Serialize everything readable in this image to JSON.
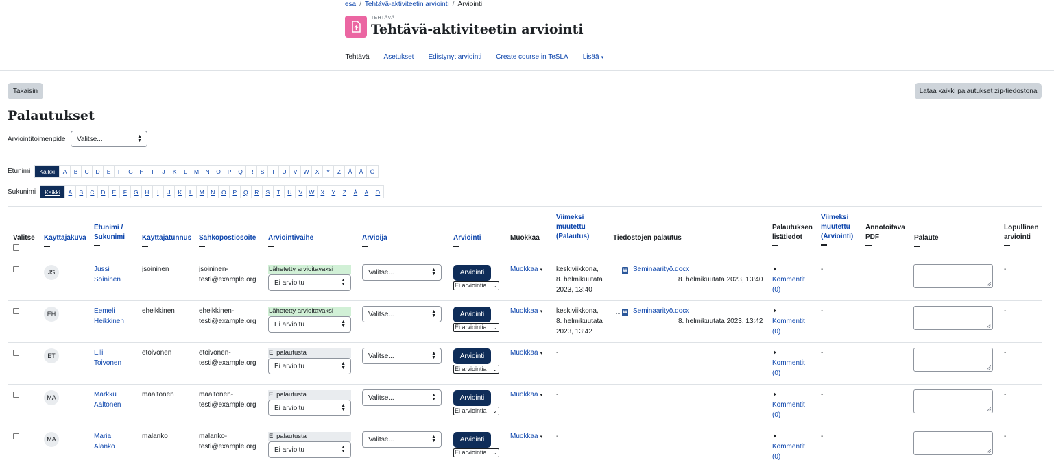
{
  "breadcrumb": [
    "esa",
    "Tehtävä-aktiviteetin arviointi",
    "Arviointi"
  ],
  "activity": {
    "kind": "TEHTÄVÄ",
    "title": "Tehtävä-aktiviteetin arviointi",
    "icon": "assignment-upload-icon",
    "icon_color": "#eb66a2"
  },
  "nav": {
    "tabs": [
      "Tehtävä",
      "Asetukset",
      "Edistynyt arviointi",
      "Create course in TeSLA",
      "Lisää"
    ],
    "active": "Tehtävä"
  },
  "buttons": {
    "back": "Takaisin",
    "download_all": "Lataa kaikki palautukset zip-tiedostona"
  },
  "page_title": "Palautukset",
  "grading_action": {
    "label": "Arviointitoimenpide",
    "value": "Valitse..."
  },
  "first_name_filter": {
    "label": "Etunimi",
    "letters": [
      "Kaikki",
      "A",
      "B",
      "C",
      "D",
      "E",
      "F",
      "G",
      "H",
      "I",
      "J",
      "K",
      "L",
      "M",
      "N",
      "O",
      "P",
      "Q",
      "R",
      "S",
      "T",
      "U",
      "V",
      "W",
      "X",
      "Y",
      "Z",
      "Å",
      "Ä",
      "Ö"
    ],
    "selected": "Kaikki"
  },
  "last_name_filter": {
    "label": "Sukunimi",
    "letters": [
      "Kaikki",
      "A",
      "B",
      "C",
      "D",
      "E",
      "F",
      "G",
      "H",
      "I",
      "J",
      "K",
      "L",
      "M",
      "N",
      "O",
      "P",
      "Q",
      "R",
      "S",
      "T",
      "U",
      "V",
      "W",
      "X",
      "Y",
      "Z",
      "Å",
      "Ä",
      "Ö"
    ],
    "selected": "Kaikki"
  },
  "table": {
    "headers": {
      "select": "Valitse",
      "avatar": "Käyttäjäkuva",
      "name": [
        "Etunimi /",
        "Sukunimi"
      ],
      "username": "Käyttäjätunnus",
      "email": "Sähköpostiosoite",
      "status": "Arviointivaihe",
      "marker": "Arvioija",
      "grade": "Arviointi",
      "edit": "Muokkaa",
      "modified": [
        "Viimeksi",
        "muutettu",
        "(Palautus)"
      ],
      "files": "Tiedostojen palautus",
      "submission_comments": [
        "Palautuksen",
        "lisätiedot"
      ],
      "grade_modified": [
        "Viimeksi",
        "muutettu",
        "(Arviointi)"
      ],
      "annotate_pdf": [
        "Annotoitava",
        "PDF"
      ],
      "feedback": "Palaute",
      "final_grade": [
        "Lopullinen",
        "arviointi"
      ]
    },
    "rows": [
      {
        "initials": "JS",
        "first": "Jussi",
        "last": "Soininen",
        "username": "jsoininen",
        "email": [
          "jsoininen-",
          "testi@example.org"
        ],
        "status": "Lähetetty arvioitavaksi",
        "status_kind": "sent",
        "workflow": "Ei arvioitu",
        "marker": "Valitse...",
        "grade_button": "Arviointi",
        "grade_value": "Ei arviointia",
        "edit": "Muokkaa",
        "modified": [
          "keskiviikkona,",
          "8. helmikuutata",
          "2023, 13:40"
        ],
        "file": "Seminaarityö.docx",
        "file_date": "8. helmikuutata 2023, 13:40",
        "comments": [
          "Kommentit",
          "(0)"
        ],
        "grade_modified": "-",
        "final": "-"
      },
      {
        "initials": "EH",
        "first": "Eemeli",
        "last": "Heikkinen",
        "username": "eheikkinen",
        "email": [
          "eheikkinen-",
          "testi@example.org"
        ],
        "status": "Lähetetty arvioitavaksi",
        "status_kind": "sent",
        "workflow": "Ei arvioitu",
        "marker": "Valitse...",
        "grade_button": "Arviointi",
        "grade_value": "Ei arviointia",
        "edit": "Muokkaa",
        "modified": [
          "keskiviikkona,",
          "8. helmikuutata",
          "2023, 13:42"
        ],
        "file": "Seminaarityö.docx",
        "file_date": "8. helmikuutata 2023, 13:42",
        "comments": [
          "Kommentit",
          "(0)"
        ],
        "grade_modified": "-",
        "final": "-"
      },
      {
        "initials": "ET",
        "first": "Elli",
        "last": "Toivonen",
        "username": "etoivonen",
        "email": [
          "etoivonen-",
          "testi@example.org"
        ],
        "status": "Ei palautusta",
        "status_kind": "none",
        "workflow": "Ei arvioitu",
        "marker": "Valitse...",
        "grade_button": "Arviointi",
        "grade_value": "Ei arviointia",
        "edit": "Muokkaa",
        "modified": [
          "-"
        ],
        "file": "",
        "file_date": "",
        "comments": [
          "Kommentit",
          "(0)"
        ],
        "grade_modified": "-",
        "final": "-"
      },
      {
        "initials": "MA",
        "first": "Markku",
        "last": "Aaltonen",
        "username": "maaltonen",
        "email": [
          "maaltonen-",
          "testi@example.org"
        ],
        "status": "Ei palautusta",
        "status_kind": "none",
        "workflow": "Ei arvioitu",
        "marker": "Valitse...",
        "grade_button": "Arviointi",
        "grade_value": "Ei arviointia",
        "edit": "Muokkaa",
        "modified": [
          "-"
        ],
        "file": "",
        "file_date": "",
        "comments": [
          "Kommentit",
          "(0)"
        ],
        "grade_modified": "-",
        "final": "-"
      },
      {
        "initials": "MA",
        "first": "Maria",
        "last": "Alanko",
        "username": "malanko",
        "email": [
          "malanko-",
          "testi@example.org"
        ],
        "status": "Ei palautusta",
        "status_kind": "none",
        "workflow": "Ei arvioitu",
        "marker": "Valitse...",
        "grade_button": "Arviointi",
        "grade_value": "Ei arviointia",
        "edit": "Muokkaa",
        "modified": [
          "-"
        ],
        "file": "",
        "file_date": "",
        "comments": [
          "Kommentit",
          "(0)"
        ],
        "grade_modified": "-",
        "final": "-"
      }
    ]
  }
}
